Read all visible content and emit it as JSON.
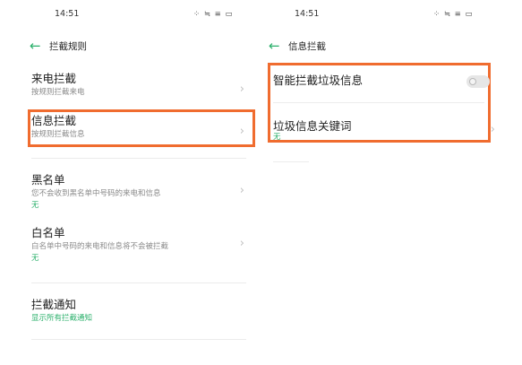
{
  "left": {
    "status": {
      "time": "14:51",
      "icons": "⁘ ≒ ≡ ▭"
    },
    "header": {
      "title": "拦截规则"
    },
    "items": [
      {
        "title": "来电拦截",
        "subtitle": "按规则拦截来电"
      },
      {
        "title": "信息拦截",
        "subtitle": "按规则拦截信息"
      },
      {
        "title": "黑名单",
        "subtitle": "您不会收到黑名单中号码的来电和信息",
        "status": "无"
      },
      {
        "title": "白名单",
        "subtitle": "白名单中号码的来电和信息将不会被拦截",
        "status": "无"
      },
      {
        "title": "拦截通知",
        "status": "显示所有拦截通知"
      }
    ]
  },
  "right": {
    "status": {
      "time": "14:51",
      "icons": "⁘ ≒ ≡ ▭"
    },
    "header": {
      "title": "信息拦截"
    },
    "items": [
      {
        "title": "智能拦截垃圾信息",
        "toggle_on": false
      },
      {
        "title": "垃圾信息关键词",
        "status": "无"
      }
    ]
  },
  "colors": {
    "accent": "#2bb06b",
    "highlight": "#f06c2f"
  },
  "icons": {
    "back": "back-arrow-icon",
    "chevron": "chevron-right-icon",
    "status_bar": "signal-wifi-battery-icons"
  }
}
